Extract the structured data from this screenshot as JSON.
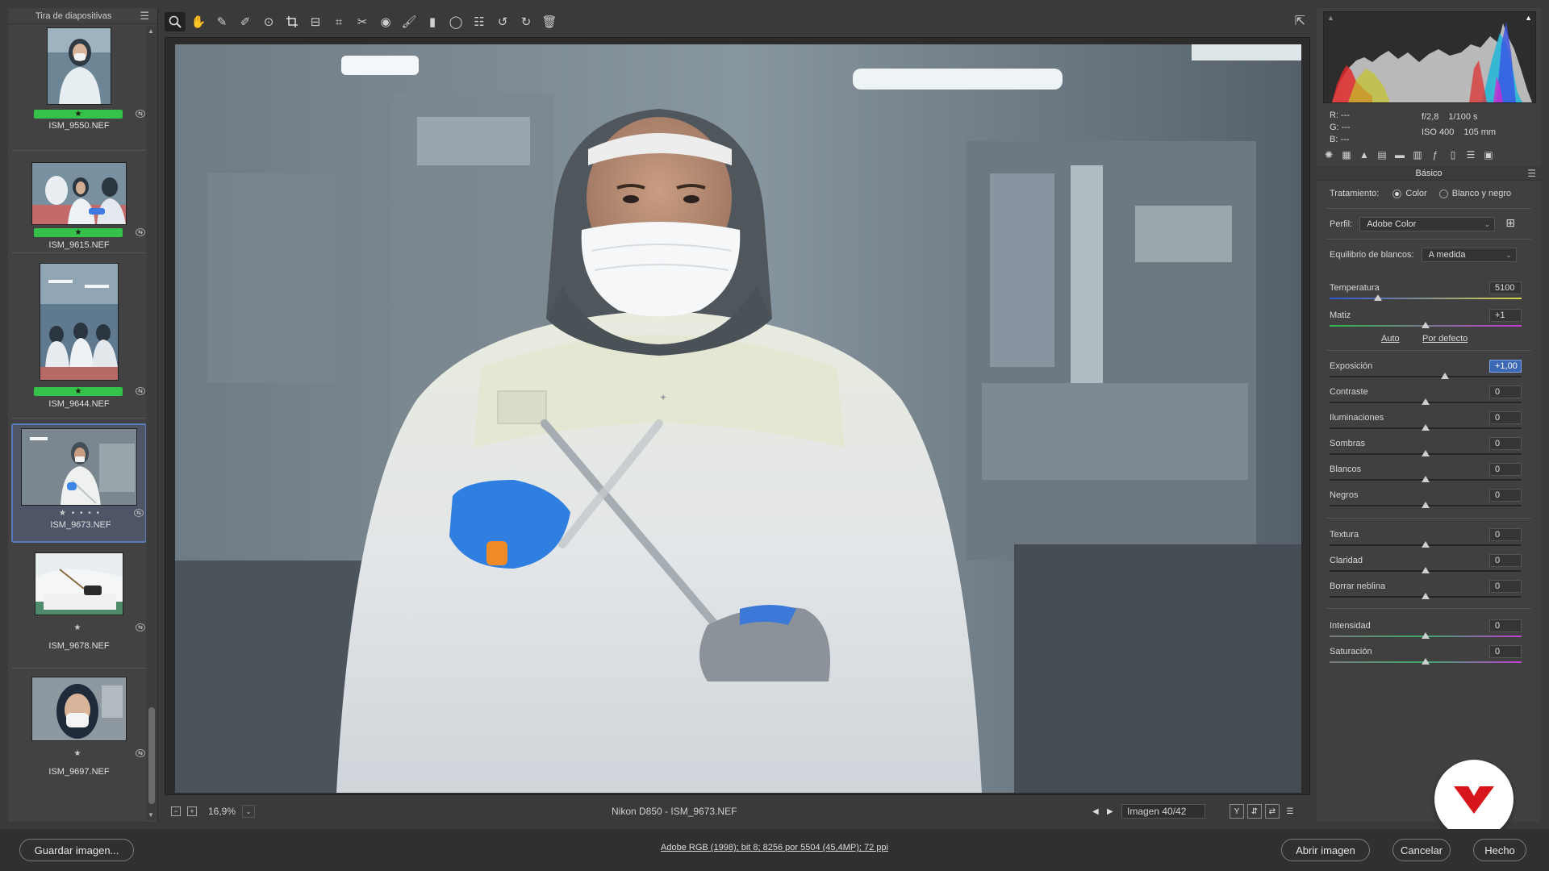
{
  "filmstrip": {
    "title": "Tira de diapositivas",
    "items": [
      {
        "name": "ISM_9550.NEF",
        "rating": "★",
        "labeled": true,
        "selected": false
      },
      {
        "name": "ISM_9615.NEF",
        "rating": "★",
        "labeled": true,
        "selected": false
      },
      {
        "name": "ISM_9644.NEF",
        "rating": "★",
        "labeled": true,
        "selected": false
      },
      {
        "name": "ISM_9673.NEF",
        "rating": "★ • • • •",
        "labeled": false,
        "selected": true
      },
      {
        "name": "ISM_9678.NEF",
        "rating": "★",
        "labeled": false,
        "selected": false
      },
      {
        "name": "ISM_9697.NEF",
        "rating": "★",
        "labeled": false,
        "selected": false
      }
    ]
  },
  "statusbar": {
    "zoom": "16,9%",
    "camera": "Nikon D850 -  ISM_9673.NEF",
    "counter": "Imagen 40/42",
    "view_y": "Y"
  },
  "panel": {
    "rgb": {
      "r": "R:  ---",
      "g": "G:  ---",
      "b": "B:  ---"
    },
    "aperture": "f/2,8",
    "shutter": "1/100 s",
    "iso": "ISO 400",
    "focal": "105 mm",
    "section_title": "Básico",
    "treatment_label": "Tratamiento:",
    "treatment_color": "Color",
    "treatment_bw": "Blanco y negro",
    "profile_label": "Perfil:",
    "profile_value": "Adobe Color",
    "wb_label": "Equilibrio de blancos:",
    "wb_value": "A medida",
    "auto": "Auto",
    "default": "Por defecto",
    "sliders": [
      {
        "label": "Temperatura",
        "value": "5100",
        "pos": 0.25
      },
      {
        "label": "Matiz",
        "value": "+1",
        "pos": 0.5
      },
      {
        "label": "Exposición",
        "value": "+1,00",
        "pos": 0.6
      },
      {
        "label": "Contraste",
        "value": "0",
        "pos": 0.5
      },
      {
        "label": "Iluminaciones",
        "value": "0",
        "pos": 0.5
      },
      {
        "label": "Sombras",
        "value": "0",
        "pos": 0.5
      },
      {
        "label": "Blancos",
        "value": "0",
        "pos": 0.5
      },
      {
        "label": "Negros",
        "value": "0",
        "pos": 0.5
      },
      {
        "label": "Textura",
        "value": "0",
        "pos": 0.5
      },
      {
        "label": "Claridad",
        "value": "0",
        "pos": 0.5
      },
      {
        "label": "Borrar neblina",
        "value": "0",
        "pos": 0.5
      },
      {
        "label": "Intensidad",
        "value": "0",
        "pos": 0.5
      },
      {
        "label": "Saturación",
        "value": "0",
        "pos": 0.5
      }
    ]
  },
  "footer": {
    "save": "Guardar imagen...",
    "workflow": "Adobe RGB (1998); bit 8; 8256 por 5504 (45,4MP); 72 ppi",
    "open": "Abrir imagen",
    "cancel": "Cancelar",
    "done": "Hecho"
  },
  "colors": {
    "label_green": "#35c24a",
    "selection_blue": "#5b7ab8",
    "active_field": "#3b67b3",
    "brand_red": "#d7161b"
  },
  "icons": [
    "zoom-icon",
    "hand-icon",
    "white-balance-icon",
    "color-sampler-icon",
    "target-adjust-icon",
    "crop-icon",
    "straighten-icon",
    "transform-icon",
    "spot-removal-icon",
    "red-eye-icon",
    "adjustment-brush-icon",
    "graduated-filter-icon",
    "radial-filter-icon",
    "preferences-icon",
    "rotate-left-icon",
    "rotate-right-icon",
    "trash-icon"
  ]
}
